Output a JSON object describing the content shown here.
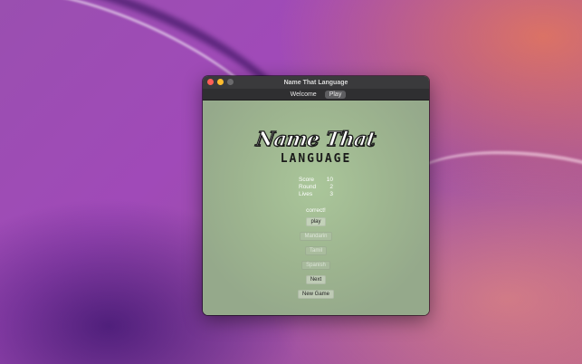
{
  "window": {
    "title": "Name That Language"
  },
  "tabs": [
    {
      "label": "Welcome"
    },
    {
      "label": "Play"
    }
  ],
  "logo": {
    "line1": "Name That",
    "line2": "LANGUAGE"
  },
  "stats": {
    "score_label": "Score",
    "score_value": "10",
    "round_label": "Round",
    "round_value": "2",
    "lives_label": "Lives",
    "lives_value": "3"
  },
  "result_text": "correct!",
  "buttons": {
    "play": "play",
    "option1": "Mandarin",
    "option2": "Tamil",
    "option3": "Spanish",
    "next": "Next",
    "new_game": "New Game"
  },
  "colors": {
    "content_bg": "#9fb78f",
    "titlebar": "#3a3a3c"
  }
}
